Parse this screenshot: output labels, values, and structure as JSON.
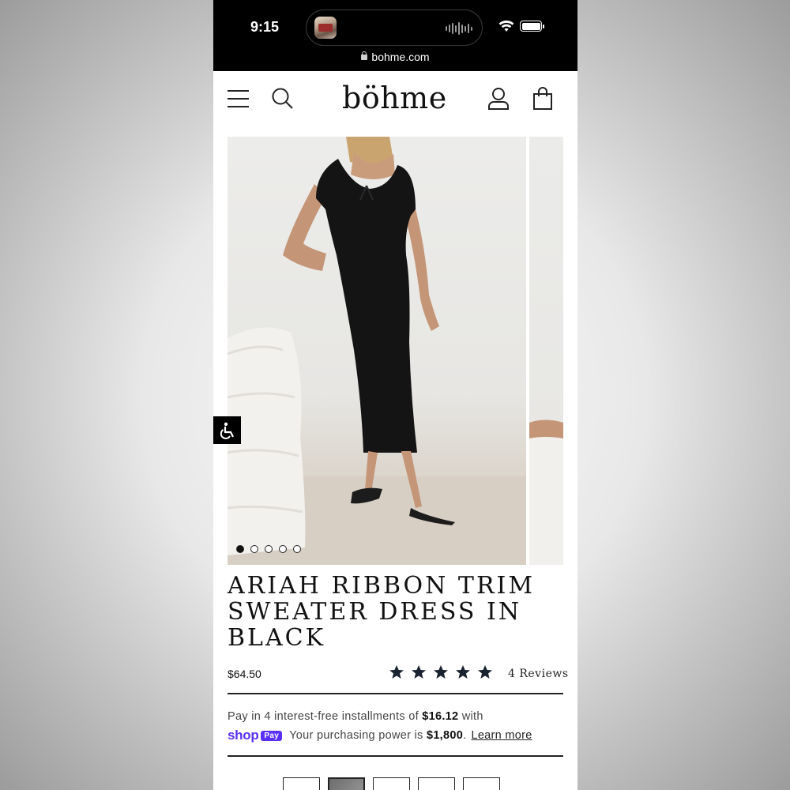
{
  "status_bar": {
    "time": "9:15",
    "url": "bohme.com"
  },
  "header": {
    "logo": "böhme",
    "icons": [
      "menu-icon",
      "search-icon",
      "account-icon",
      "bag-icon"
    ]
  },
  "gallery": {
    "image_count": 5,
    "active_index": 0
  },
  "product": {
    "title": "ARIAH RIBBON TRIM SWEATER DRESS IN BLACK",
    "price": "$64.50",
    "rating": 5,
    "reviews_label": "4 Reviews"
  },
  "payment": {
    "line1_prefix": "Pay in 4 interest-free installments of ",
    "installment": "$16.12",
    "line1_suffix": " with",
    "shop_logo": "shop",
    "pay_badge": "Pay",
    "line2_prefix": "Your purchasing power is ",
    "purchasing_power": "$1,800",
    "line2_suffix": ".",
    "learn_more": "Learn more"
  },
  "colors": {
    "accent": "#5a31f4",
    "text": "#111111",
    "status_bar": "#000000"
  }
}
